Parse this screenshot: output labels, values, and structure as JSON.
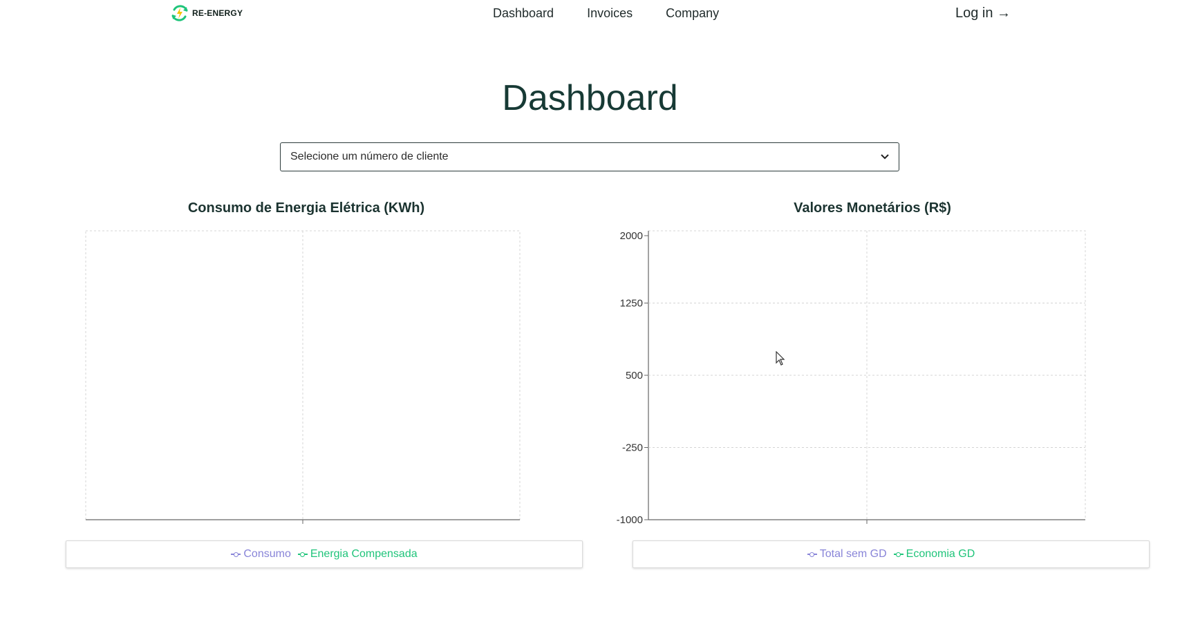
{
  "header": {
    "logo_text": "RE-ENERGY",
    "nav": [
      {
        "label": "Dashboard"
      },
      {
        "label": "Invoices"
      },
      {
        "label": "Company"
      }
    ],
    "login_label": "Log in →"
  },
  "page": {
    "title": "Dashboard",
    "client_select": {
      "selected": "Selecione um número de cliente"
    }
  },
  "colors": {
    "series_purple": "#8884d8",
    "series_green": "#1fc47a",
    "title": "#173a35"
  },
  "chart_data": [
    {
      "type": "line",
      "title": "Consumo de Energia Elétrica (KWh)",
      "xlabel": "",
      "ylabel": "",
      "x": [],
      "series": [
        {
          "name": "Consumo",
          "values": [],
          "color": "#8884d8"
        },
        {
          "name": "Energia Compensada",
          "values": [],
          "color": "#1fc47a"
        }
      ],
      "yticks": [],
      "grid": true,
      "legend": "bottom"
    },
    {
      "type": "line",
      "title": "Valores Monetários (R$)",
      "xlabel": "",
      "ylabel": "",
      "x": [],
      "ylim": [
        -1000,
        2000
      ],
      "yticks": [
        2000,
        1250,
        500,
        -250,
        -1000
      ],
      "series": [
        {
          "name": "Total sem GD",
          "values": [],
          "color": "#8884d8"
        },
        {
          "name": "Economia GD",
          "values": [],
          "color": "#1fc47a"
        }
      ],
      "grid": true,
      "legend": "bottom"
    }
  ]
}
